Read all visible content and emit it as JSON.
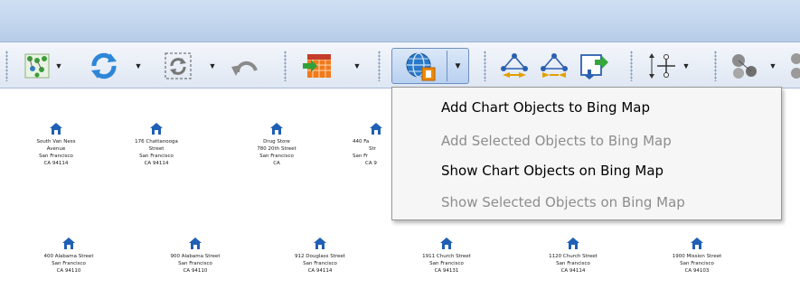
{
  "toolbar": {
    "buttons": [
      {
        "icon": "layout-icon"
      },
      {
        "icon": "refresh-icon"
      },
      {
        "icon": "refresh-selection-icon"
      },
      {
        "icon": "undo-icon"
      },
      {
        "icon": "grid-import-icon"
      },
      {
        "icon": "bing-map-globe-icon"
      },
      {
        "icon": "link-nodes-icon"
      },
      {
        "icon": "link-nodes-alt-icon"
      },
      {
        "icon": "export-icon"
      },
      {
        "icon": "hierarchy-icon"
      },
      {
        "icon": "nodes-filter-icon"
      }
    ],
    "dropdown_arrow": "▼"
  },
  "chart_nodes_row1": [
    {
      "lines": [
        "South Van Ness",
        "Avenue",
        "San Francisco",
        "CA 94114"
      ]
    },
    {
      "lines": [
        "176 Chattanooga",
        "Street",
        "San Francisco",
        "CA 94114"
      ]
    },
    {
      "lines": [
        "Drug Store",
        "780 20th Street",
        "San Francisco",
        "CA"
      ]
    },
    {
      "lines": [
        "440 Fa",
        "Str",
        "San Fr",
        "CA 9"
      ]
    }
  ],
  "chart_nodes_row2": [
    {
      "lines": [
        "400 Alabama Street",
        "San Francisco",
        "CA 94110"
      ]
    },
    {
      "lines": [
        "900 Alabama Street",
        "San Francisco",
        "CA 94110"
      ]
    },
    {
      "lines": [
        "912 Douglass Street",
        "San Francisco",
        "CA 94114"
      ]
    },
    {
      "lines": [
        "1911 Church Street",
        "San Francisco",
        "CA 94131"
      ]
    },
    {
      "lines": [
        "1120 Church Street",
        "San Francisco",
        "CA 94114"
      ]
    },
    {
      "lines": [
        "1900 Mission Street",
        "San Francisco",
        "CA 94103"
      ]
    }
  ],
  "menu": {
    "items": [
      {
        "label": "Add Chart Objects to Bing Map",
        "enabled": true
      },
      {
        "label": "Add Selected Objects to Bing Map",
        "enabled": false
      },
      {
        "label": "Show Chart Objects on Bing Map",
        "enabled": true
      },
      {
        "label": "Show Selected Objects on Bing Map",
        "enabled": false
      }
    ]
  },
  "colors": {
    "titlebar": "#b7cde8",
    "toolbar": "#dfe7f3",
    "house_blue": "#1f5fb4",
    "menu_bg": "#f6f6f6",
    "disabled_text": "#8d8d8d"
  }
}
